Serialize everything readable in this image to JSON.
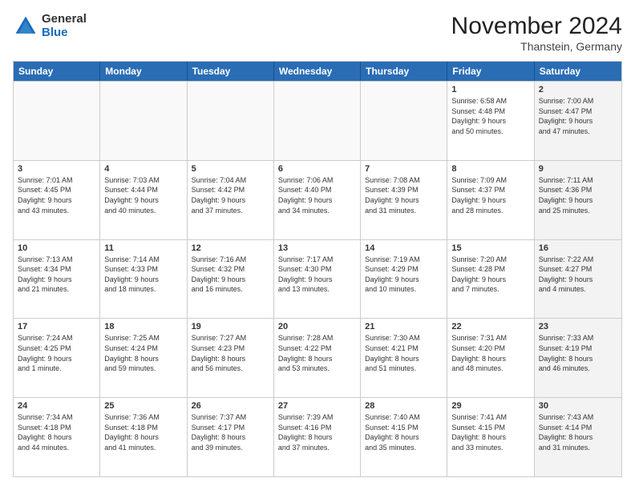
{
  "logo": {
    "general": "General",
    "blue": "Blue"
  },
  "title": "November 2024",
  "location": "Thanstein, Germany",
  "header_days": [
    "Sunday",
    "Monday",
    "Tuesday",
    "Wednesday",
    "Thursday",
    "Friday",
    "Saturday"
  ],
  "rows": [
    [
      {
        "day": "",
        "info": "",
        "empty": true
      },
      {
        "day": "",
        "info": "",
        "empty": true
      },
      {
        "day": "",
        "info": "",
        "empty": true
      },
      {
        "day": "",
        "info": "",
        "empty": true
      },
      {
        "day": "",
        "info": "",
        "empty": true
      },
      {
        "day": "1",
        "info": "Sunrise: 6:58 AM\nSunset: 4:48 PM\nDaylight: 9 hours\nand 50 minutes.",
        "empty": false,
        "shaded": false
      },
      {
        "day": "2",
        "info": "Sunrise: 7:00 AM\nSunset: 4:47 PM\nDaylight: 9 hours\nand 47 minutes.",
        "empty": false,
        "shaded": true
      }
    ],
    [
      {
        "day": "3",
        "info": "Sunrise: 7:01 AM\nSunset: 4:45 PM\nDaylight: 9 hours\nand 43 minutes.",
        "empty": false,
        "shaded": false
      },
      {
        "day": "4",
        "info": "Sunrise: 7:03 AM\nSunset: 4:44 PM\nDaylight: 9 hours\nand 40 minutes.",
        "empty": false,
        "shaded": false
      },
      {
        "day": "5",
        "info": "Sunrise: 7:04 AM\nSunset: 4:42 PM\nDaylight: 9 hours\nand 37 minutes.",
        "empty": false,
        "shaded": false
      },
      {
        "day": "6",
        "info": "Sunrise: 7:06 AM\nSunset: 4:40 PM\nDaylight: 9 hours\nand 34 minutes.",
        "empty": false,
        "shaded": false
      },
      {
        "day": "7",
        "info": "Sunrise: 7:08 AM\nSunset: 4:39 PM\nDaylight: 9 hours\nand 31 minutes.",
        "empty": false,
        "shaded": false
      },
      {
        "day": "8",
        "info": "Sunrise: 7:09 AM\nSunset: 4:37 PM\nDaylight: 9 hours\nand 28 minutes.",
        "empty": false,
        "shaded": false
      },
      {
        "day": "9",
        "info": "Sunrise: 7:11 AM\nSunset: 4:36 PM\nDaylight: 9 hours\nand 25 minutes.",
        "empty": false,
        "shaded": true
      }
    ],
    [
      {
        "day": "10",
        "info": "Sunrise: 7:13 AM\nSunset: 4:34 PM\nDaylight: 9 hours\nand 21 minutes.",
        "empty": false,
        "shaded": false
      },
      {
        "day": "11",
        "info": "Sunrise: 7:14 AM\nSunset: 4:33 PM\nDaylight: 9 hours\nand 18 minutes.",
        "empty": false,
        "shaded": false
      },
      {
        "day": "12",
        "info": "Sunrise: 7:16 AM\nSunset: 4:32 PM\nDaylight: 9 hours\nand 16 minutes.",
        "empty": false,
        "shaded": false
      },
      {
        "day": "13",
        "info": "Sunrise: 7:17 AM\nSunset: 4:30 PM\nDaylight: 9 hours\nand 13 minutes.",
        "empty": false,
        "shaded": false
      },
      {
        "day": "14",
        "info": "Sunrise: 7:19 AM\nSunset: 4:29 PM\nDaylight: 9 hours\nand 10 minutes.",
        "empty": false,
        "shaded": false
      },
      {
        "day": "15",
        "info": "Sunrise: 7:20 AM\nSunset: 4:28 PM\nDaylight: 9 hours\nand 7 minutes.",
        "empty": false,
        "shaded": false
      },
      {
        "day": "16",
        "info": "Sunrise: 7:22 AM\nSunset: 4:27 PM\nDaylight: 9 hours\nand 4 minutes.",
        "empty": false,
        "shaded": true
      }
    ],
    [
      {
        "day": "17",
        "info": "Sunrise: 7:24 AM\nSunset: 4:25 PM\nDaylight: 9 hours\nand 1 minute.",
        "empty": false,
        "shaded": false
      },
      {
        "day": "18",
        "info": "Sunrise: 7:25 AM\nSunset: 4:24 PM\nDaylight: 8 hours\nand 59 minutes.",
        "empty": false,
        "shaded": false
      },
      {
        "day": "19",
        "info": "Sunrise: 7:27 AM\nSunset: 4:23 PM\nDaylight: 8 hours\nand 56 minutes.",
        "empty": false,
        "shaded": false
      },
      {
        "day": "20",
        "info": "Sunrise: 7:28 AM\nSunset: 4:22 PM\nDaylight: 8 hours\nand 53 minutes.",
        "empty": false,
        "shaded": false
      },
      {
        "day": "21",
        "info": "Sunrise: 7:30 AM\nSunset: 4:21 PM\nDaylight: 8 hours\nand 51 minutes.",
        "empty": false,
        "shaded": false
      },
      {
        "day": "22",
        "info": "Sunrise: 7:31 AM\nSunset: 4:20 PM\nDaylight: 8 hours\nand 48 minutes.",
        "empty": false,
        "shaded": false
      },
      {
        "day": "23",
        "info": "Sunrise: 7:33 AM\nSunset: 4:19 PM\nDaylight: 8 hours\nand 46 minutes.",
        "empty": false,
        "shaded": true
      }
    ],
    [
      {
        "day": "24",
        "info": "Sunrise: 7:34 AM\nSunset: 4:18 PM\nDaylight: 8 hours\nand 44 minutes.",
        "empty": false,
        "shaded": false
      },
      {
        "day": "25",
        "info": "Sunrise: 7:36 AM\nSunset: 4:18 PM\nDaylight: 8 hours\nand 41 minutes.",
        "empty": false,
        "shaded": false
      },
      {
        "day": "26",
        "info": "Sunrise: 7:37 AM\nSunset: 4:17 PM\nDaylight: 8 hours\nand 39 minutes.",
        "empty": false,
        "shaded": false
      },
      {
        "day": "27",
        "info": "Sunrise: 7:39 AM\nSunset: 4:16 PM\nDaylight: 8 hours\nand 37 minutes.",
        "empty": false,
        "shaded": false
      },
      {
        "day": "28",
        "info": "Sunrise: 7:40 AM\nSunset: 4:15 PM\nDaylight: 8 hours\nand 35 minutes.",
        "empty": false,
        "shaded": false
      },
      {
        "day": "29",
        "info": "Sunrise: 7:41 AM\nSunset: 4:15 PM\nDaylight: 8 hours\nand 33 minutes.",
        "empty": false,
        "shaded": false
      },
      {
        "day": "30",
        "info": "Sunrise: 7:43 AM\nSunset: 4:14 PM\nDaylight: 8 hours\nand 31 minutes.",
        "empty": false,
        "shaded": true
      }
    ]
  ]
}
